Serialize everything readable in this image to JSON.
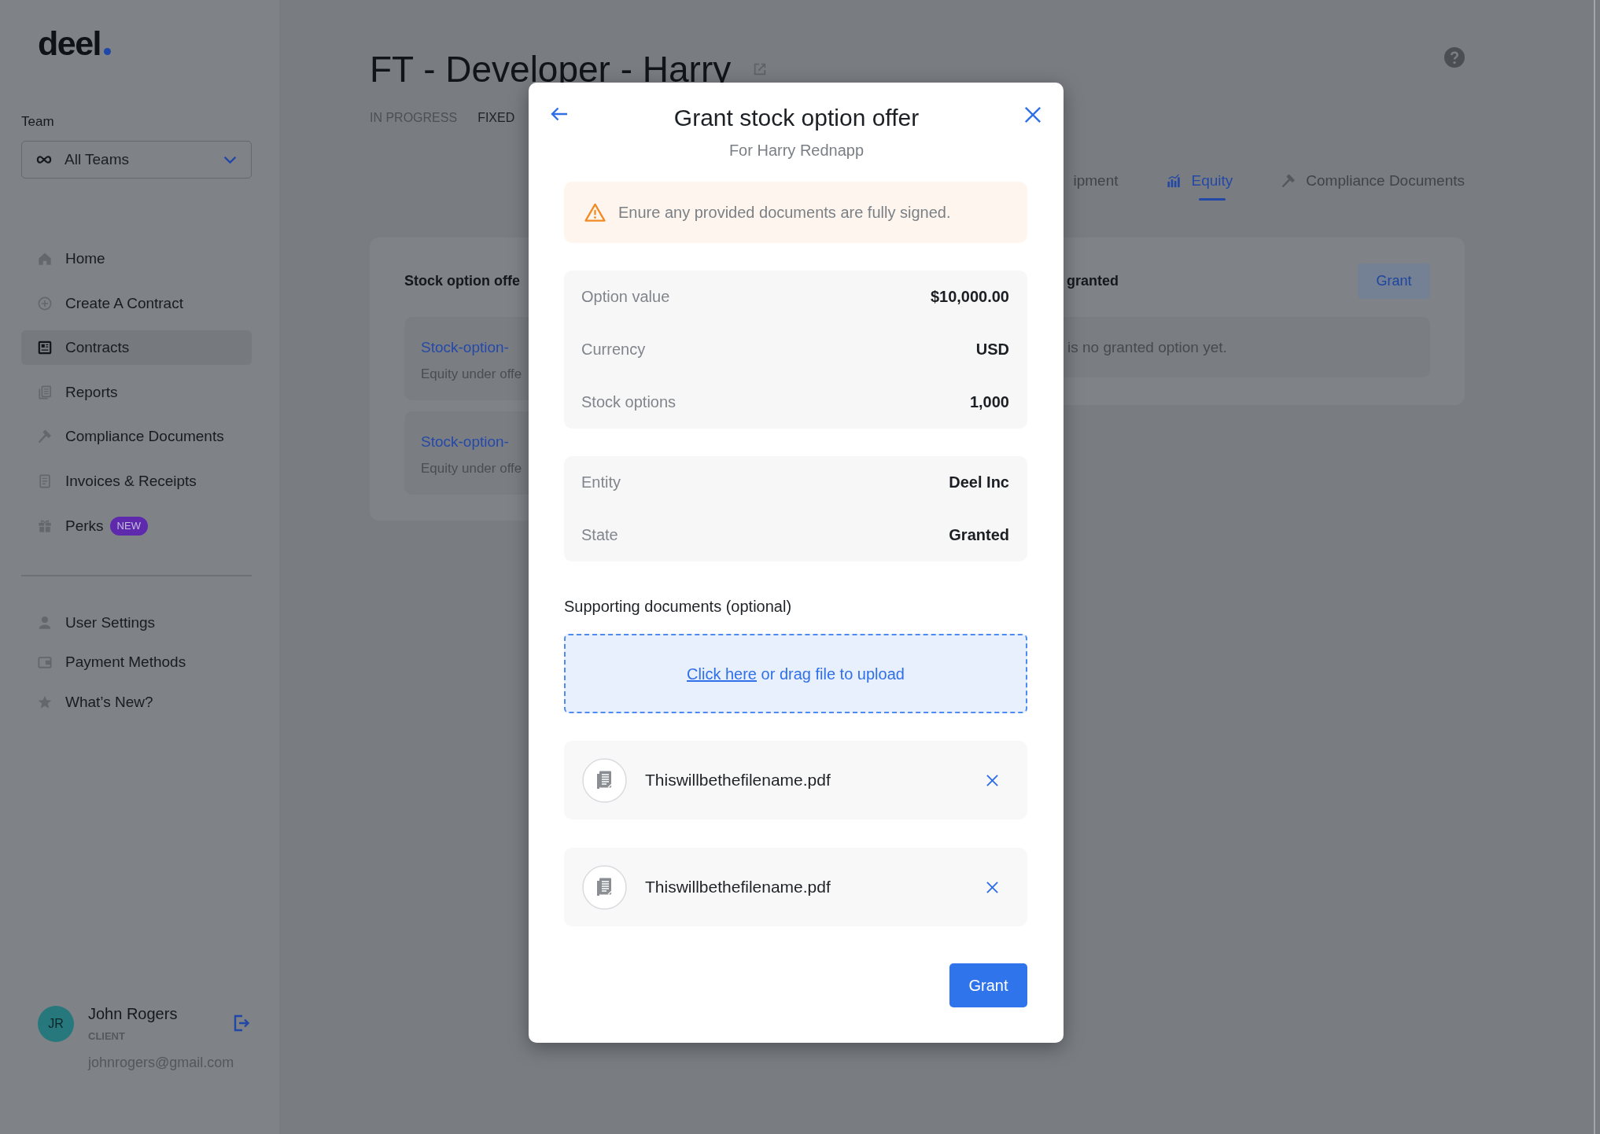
{
  "sidebar": {
    "logo": "deel",
    "team_label": "Team",
    "team_select": {
      "value": "All Teams"
    },
    "nav_items": [
      {
        "label": "Home",
        "selected": false
      },
      {
        "label": "Create A Contract",
        "selected": false
      },
      {
        "label": "Contracts",
        "selected": true
      },
      {
        "label": "Reports",
        "selected": false
      },
      {
        "label": "Compliance Documents",
        "selected": false
      },
      {
        "label": "Invoices & Receipts",
        "selected": false
      },
      {
        "label": "Perks",
        "selected": false,
        "badge": "NEW"
      }
    ],
    "secondary_items": [
      {
        "label": "User Settings",
        "selected": false
      },
      {
        "label": "Payment Methods",
        "selected": false
      },
      {
        "label": "What’s New?",
        "selected": false
      }
    ],
    "user": {
      "initials": "JR",
      "name": "John Rogers",
      "role": "CLIENT",
      "email": "johnrogers@gmail.com"
    }
  },
  "page": {
    "title": "FT - Developer - Harry",
    "status": "IN PROGRESS",
    "type": "FIXED",
    "tabs": [
      {
        "label": "ipment",
        "selected": false
      },
      {
        "label": "Equity",
        "selected": true
      },
      {
        "label": "Compliance Documents",
        "selected": false
      }
    ],
    "offers_card": {
      "title": "Stock option offe",
      "items": [
        {
          "link": "Stock-option-",
          "subtitle": "Equity under offe"
        },
        {
          "link": "Stock-option-",
          "subtitle": "Equity under offe"
        }
      ]
    },
    "granted_card": {
      "title": "granted",
      "button": "Grant",
      "empty_text": "is no granted option yet."
    }
  },
  "modal": {
    "title": "Grant stock option offer",
    "subtitle": "For Harry Rednapp",
    "warning": "Enure any provided documents are fully signed.",
    "detail_groups": [
      [
        {
          "label": "Option value",
          "value": "$10,000.00"
        },
        {
          "label": "Currency",
          "value": "USD"
        },
        {
          "label": "Stock options",
          "value": "1,000"
        }
      ],
      [
        {
          "label": "Entity",
          "value": "Deel Inc"
        },
        {
          "label": "State",
          "value": "Granted"
        }
      ]
    ],
    "documents_label": "Supporting documents (optional)",
    "upload": {
      "link": "Click here",
      "text": "or drag file to upload"
    },
    "files": [
      "Thiswillbethefilename.pdf",
      "Thiswillbethefilename.pdf"
    ],
    "button": "Grant"
  }
}
